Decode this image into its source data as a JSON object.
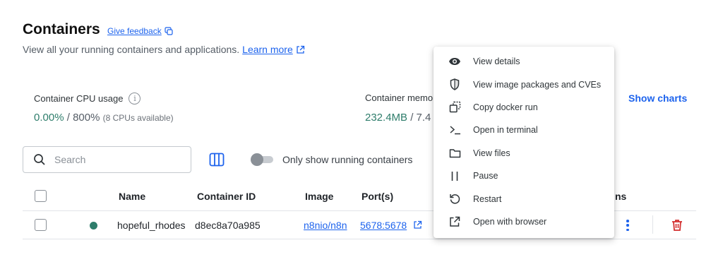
{
  "header": {
    "title": "Containers",
    "feedback_label": "Give feedback",
    "subtitle": "View all your running containers and applications.",
    "learn_more": "Learn more"
  },
  "stats": {
    "cpu_label": "Container CPU usage",
    "cpu_value": "0.00%",
    "cpu_sep": " / ",
    "cpu_max": "800%",
    "cpu_note": "(8 CPUs available)",
    "mem_label": "Container memor",
    "mem_value": "232.4MB",
    "mem_rest": " / 7.4",
    "show_charts": "Show charts"
  },
  "toolbar": {
    "search_placeholder": "Search",
    "toggle_label": "Only show running containers",
    "toggle_on": false
  },
  "table": {
    "columns": [
      "Name",
      "Container ID",
      "Image",
      "Port(s)"
    ],
    "actions_col_tail": "ns",
    "rows": [
      {
        "status_color": "#2e7d6b",
        "name": "hopeful_rhodes",
        "container_id": "d8ec8a70a985",
        "image": "n8nio/n8n",
        "ports": "5678:5678"
      }
    ]
  },
  "context_menu": {
    "items": [
      {
        "label": "View details",
        "icon": "eye-icon"
      },
      {
        "label": "View image packages and CVEs",
        "icon": "shield-icon"
      },
      {
        "label": "Copy docker run",
        "icon": "copy-icon"
      },
      {
        "label": "Open in terminal",
        "icon": "terminal-icon"
      },
      {
        "label": "View files",
        "icon": "folder-icon"
      },
      {
        "label": "Pause",
        "icon": "pause-icon"
      },
      {
        "label": "Restart",
        "icon": "restart-icon"
      },
      {
        "label": "Open with browser",
        "icon": "external-link-icon"
      }
    ]
  },
  "colors": {
    "accent": "#1d63ed",
    "running": "#2e7d6b",
    "danger": "#d32f2f"
  }
}
